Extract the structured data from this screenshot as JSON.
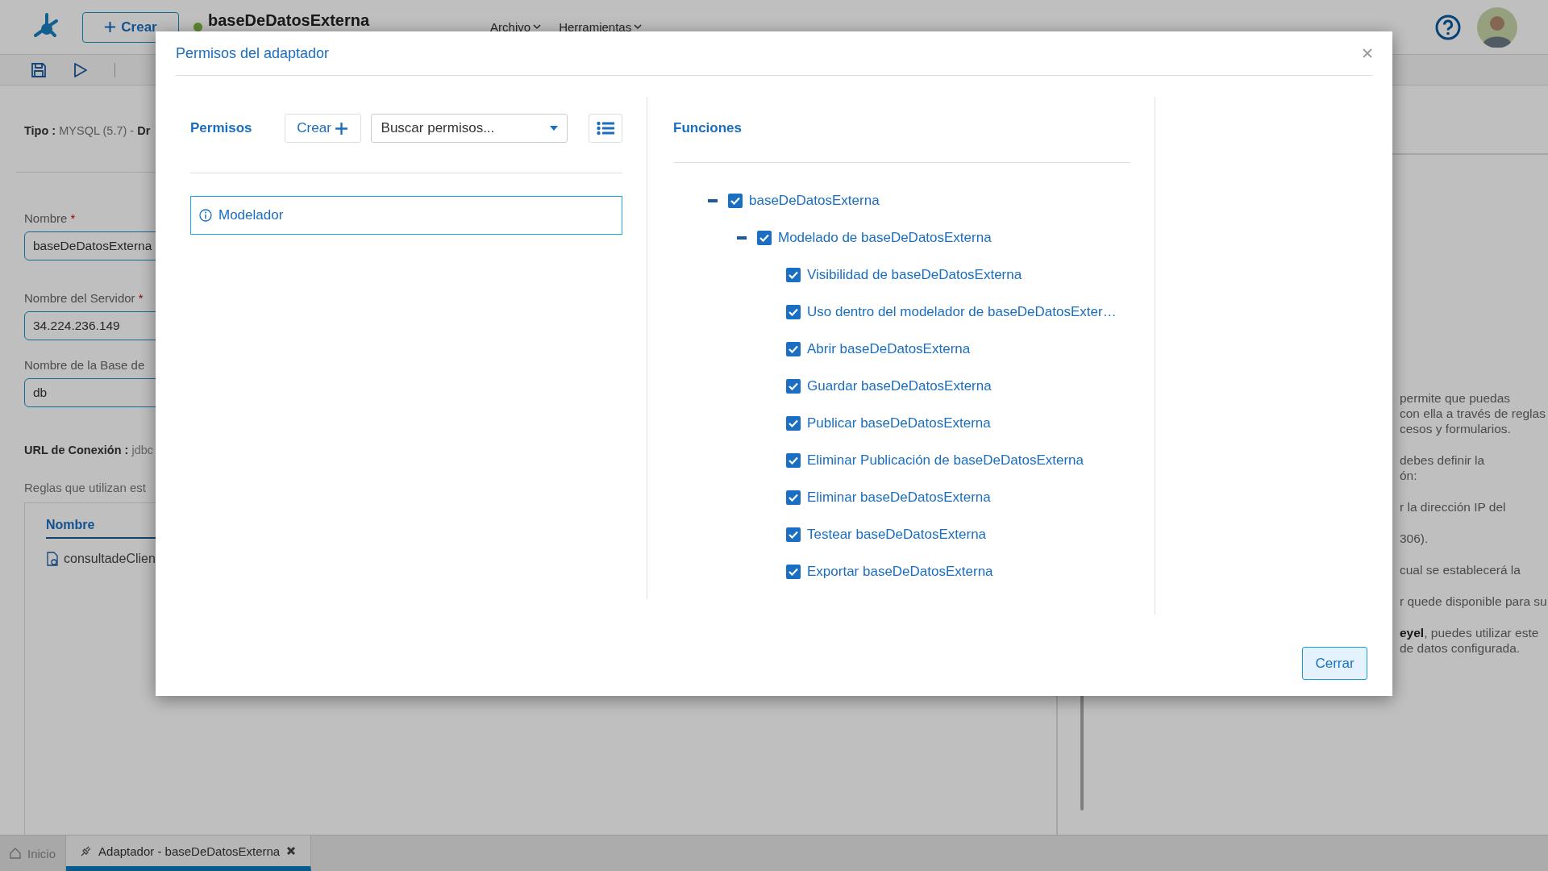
{
  "app": {
    "create_button": "Crear",
    "document_title": "baseDeDatosExterna",
    "menus": [
      "Archivo",
      "Herramientas"
    ]
  },
  "form": {
    "type_label": "Tipo :",
    "type_value": "MYSQL (5.7) -",
    "type_cut": "Dr",
    "required_mark": "*",
    "fields": [
      {
        "label": "Nombre",
        "required": true,
        "value": "baseDeDatosExterna"
      },
      {
        "label": "Nombre del Servidor",
        "required": true,
        "value": "34.224.236.149"
      },
      {
        "label": "Nombre de la Base de",
        "required": false,
        "value": "db"
      }
    ],
    "url_label": "URL de Conexión :",
    "url_value": "jdbc",
    "rules_caption": "Reglas que utilizan est",
    "rules_table": {
      "columns": [
        "Nombre"
      ],
      "rows": [
        "consultadeClien"
      ]
    }
  },
  "help_panel": {
    "paragraphs": [
      [
        "permite que puedas",
        "con ella a través de reglas",
        "cesos y formularios."
      ],
      [
        "debes definir la",
        "ón:"
      ],
      [
        "r la dirección IP del"
      ],
      [
        "306)."
      ],
      [
        "cual se establecerá la"
      ],
      [
        "r quede disponible para su"
      ],
      [
        "**eyel**, puedes utilizar este",
        "de datos configurada."
      ]
    ]
  },
  "tabs": [
    {
      "kind": "home",
      "label": "Inicio",
      "selected": false,
      "closable": false
    },
    {
      "kind": "adapter",
      "label": "Adaptador - baseDeDatosExterna",
      "selected": true,
      "closable": true
    }
  ],
  "modal": {
    "title": "Permisos del adaptador",
    "permissions": {
      "heading": "Permisos",
      "create_button": "Crear",
      "search_placeholder": "Buscar permisos...",
      "items": [
        {
          "label": "Modelador",
          "selected": true
        }
      ]
    },
    "functions": {
      "heading": "Funciones",
      "tree": [
        {
          "label": "baseDeDatosExterna",
          "checked": true,
          "expanded": true,
          "children": [
            {
              "label": "Modelado de baseDeDatosExterna",
              "checked": true,
              "expanded": true,
              "children": [
                {
                  "label": "Visibilidad de baseDeDatosExterna",
                  "checked": true
                },
                {
                  "label": "Uso dentro del modelador de baseDeDatosExter…",
                  "checked": true
                },
                {
                  "label": "Abrir baseDeDatosExterna",
                  "checked": true
                },
                {
                  "label": "Guardar baseDeDatosExterna",
                  "checked": true
                },
                {
                  "label": "Publicar baseDeDatosExterna",
                  "checked": true
                },
                {
                  "label": "Eliminar Publicación de baseDeDatosExterna",
                  "checked": true
                },
                {
                  "label": "Eliminar baseDeDatosExterna",
                  "checked": true
                },
                {
                  "label": "Testear baseDeDatosExterna",
                  "checked": true
                },
                {
                  "label": "Exportar baseDeDatosExterna",
                  "checked": true
                }
              ]
            }
          ]
        }
      ]
    },
    "close_button": "Cerrar"
  }
}
